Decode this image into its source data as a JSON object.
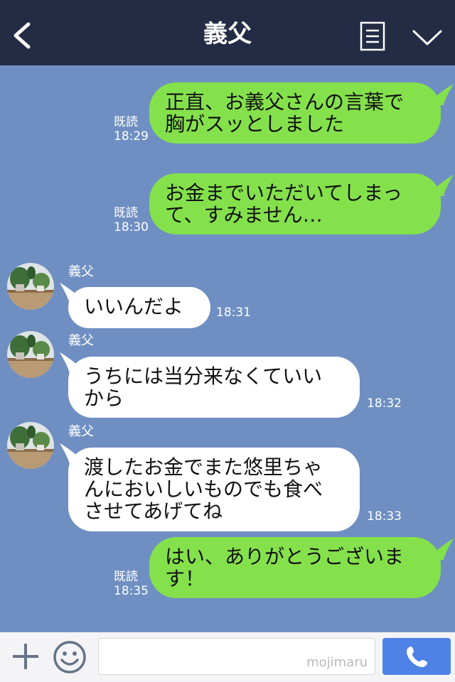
{
  "header": {
    "title": "義父",
    "icons": {
      "back": "chevron-left-icon",
      "menu": "menu-list-icon",
      "dropdown": "chevron-down-icon"
    }
  },
  "messages": [
    {
      "side": "out",
      "lines": [
        "正直、お義父さんの言葉で",
        "胸がスッとしました"
      ],
      "read_label": "既読",
      "time": "18:29"
    },
    {
      "side": "out",
      "lines": [
        "お金までいただいてしまっ",
        "て、すみません…"
      ],
      "read_label": "既読",
      "time": "18:30"
    },
    {
      "side": "in",
      "sender": "義父",
      "lines": [
        "いいんだよ"
      ],
      "time": "18:31"
    },
    {
      "side": "in",
      "sender": "義父",
      "lines": [
        "うちには当分来なくていい",
        "から"
      ],
      "time": "18:32"
    },
    {
      "side": "in",
      "sender": "義父",
      "lines": [
        "渡したお金でまた悠里ちゃ",
        "んにおいしいものでも食べ",
        "させてあげてね"
      ],
      "time": "18:33"
    },
    {
      "side": "out",
      "lines": [
        "はい、ありがとうございま",
        "す！"
      ],
      "read_label": "既読",
      "time": "18:35"
    }
  ],
  "input_bar": {
    "watermark": "mojimaru",
    "icons": {
      "add": "plus-icon",
      "emoji": "smiley-icon",
      "call": "phone-icon"
    }
  },
  "colors": {
    "header_bg": "#232c44",
    "chat_bg": "#6f8fc2",
    "outgoing_bubble": "#84e14c",
    "incoming_bubble": "#ffffff",
    "call_button": "#4f82e6"
  }
}
